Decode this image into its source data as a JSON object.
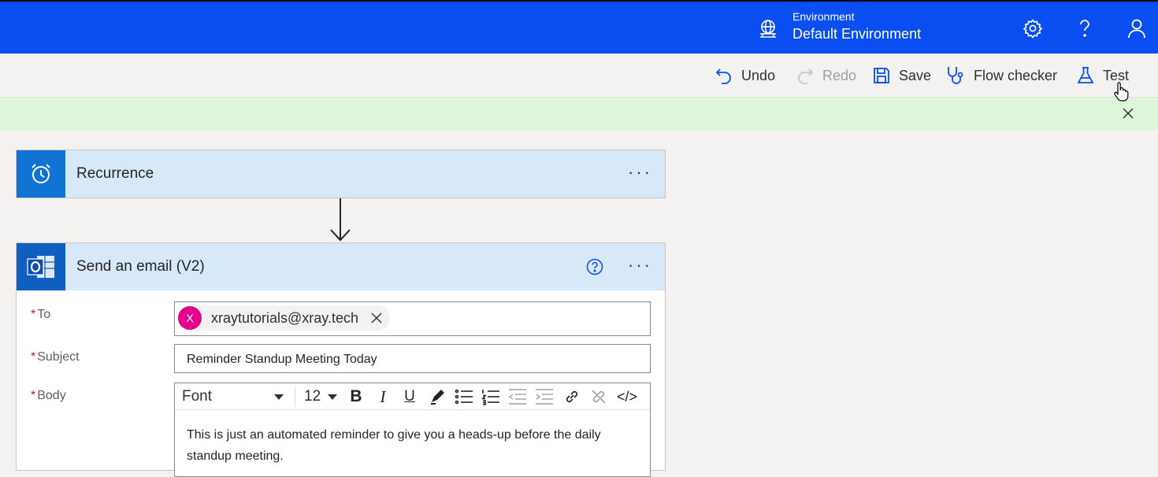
{
  "header": {
    "environment_label": "Environment",
    "environment_name": "Default Environment",
    "icons": [
      "globe-icon",
      "gear-icon",
      "help-icon",
      "user-icon"
    ]
  },
  "commandbar": {
    "undo": "Undo",
    "redo": "Redo",
    "save": "Save",
    "flow_checker": "Flow checker",
    "test": "Test"
  },
  "steps": {
    "recurrence": {
      "title": "Recurrence",
      "more": "···"
    },
    "email": {
      "title": "Send an email (V2)",
      "more": "···",
      "fields": {
        "to_label": "To",
        "to_token_initial": "X",
        "to_token_value": "xraytutorials@xray.tech",
        "subject_label": "Subject",
        "subject_value": "Reminder Standup Meeting Today",
        "body_label": "Body",
        "required_mark": "*"
      },
      "editor": {
        "font": "Font",
        "size": "12",
        "bold": "B",
        "italic": "I",
        "underline": "U",
        "code": "</>",
        "body_text": "This is just an automated reminder to give you a heads-up before the daily standup meeting."
      }
    }
  },
  "colors": {
    "topbar": "#0a4df0",
    "banner": "#dff6dd",
    "card_header": "#d7e9f8",
    "accent": "#1173d4",
    "token_avatar": "#e3008c"
  }
}
